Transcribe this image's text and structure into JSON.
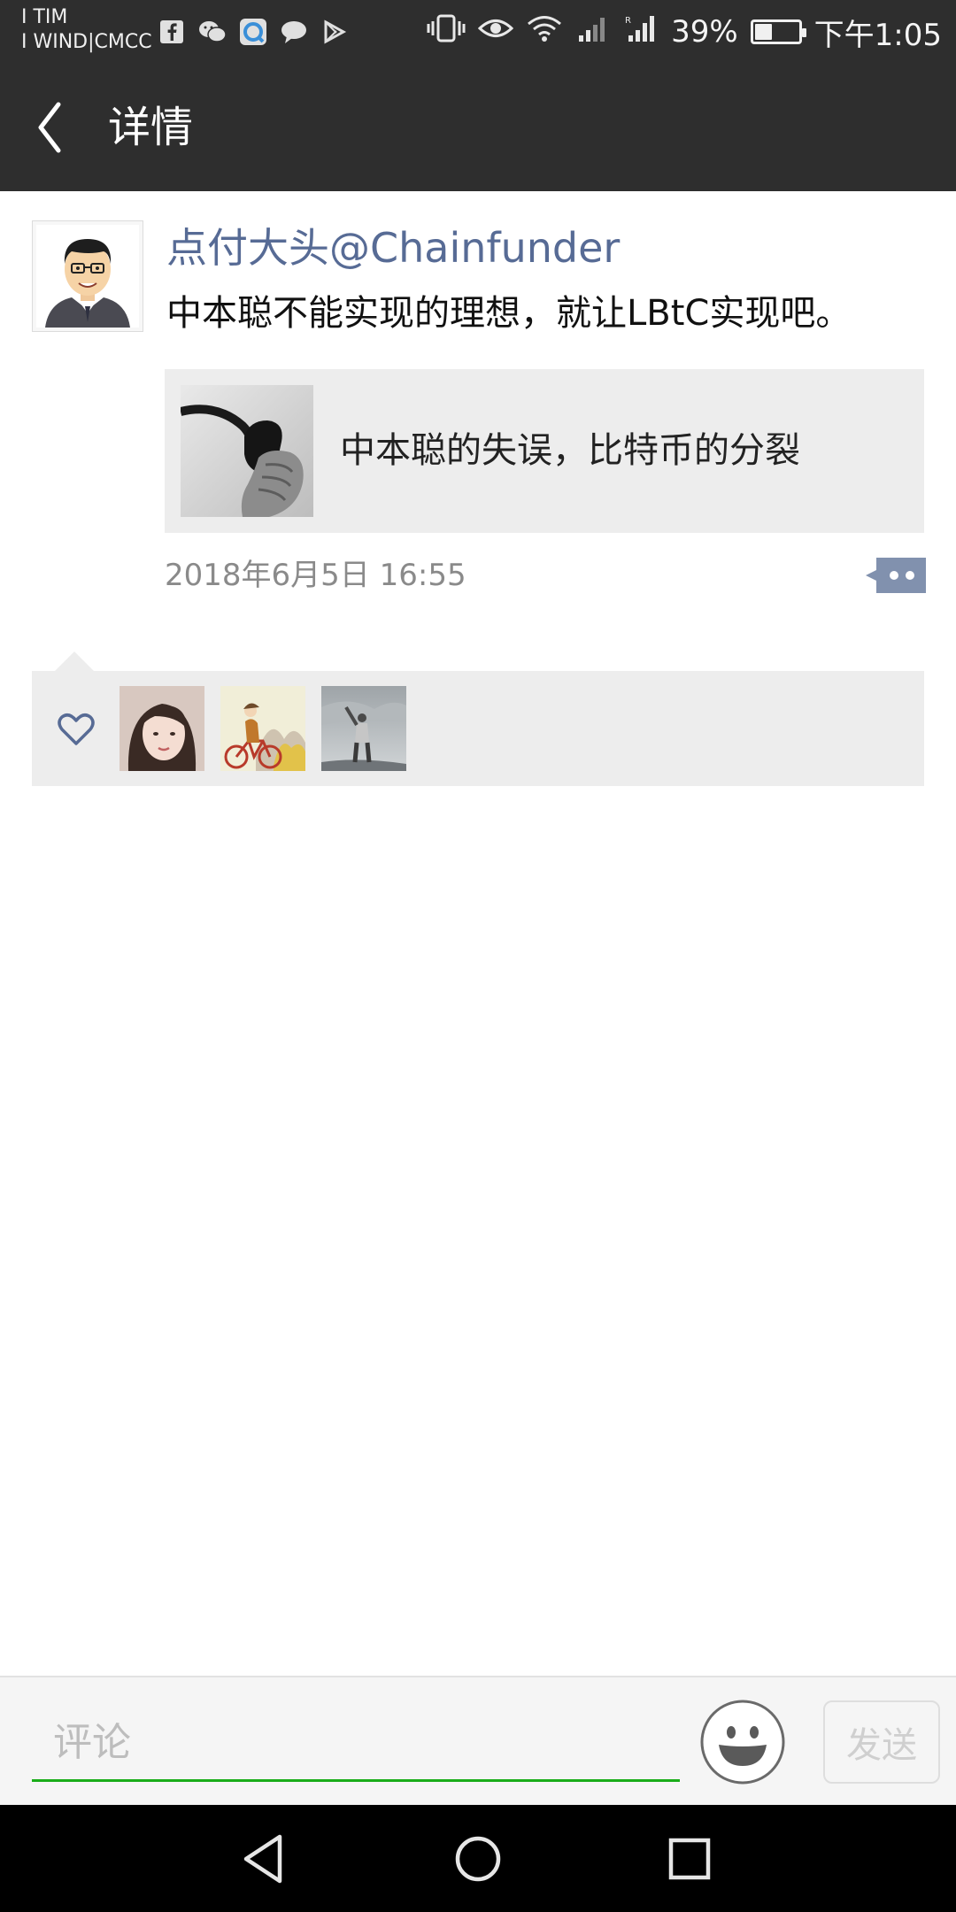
{
  "status_bar": {
    "carrier_line1": "I TIM",
    "carrier_line2": "I WIND|CMCC",
    "battery_percent": "39%",
    "battery_level": 0.39,
    "time": "下午1:05",
    "left_icons": [
      "facebook-icon",
      "wechat-icon",
      "qq-browser-icon",
      "message-icon",
      "play-store-icon"
    ],
    "right_icons": [
      "vibrate-icon",
      "eye-icon",
      "wifi-icon",
      "signal-icon",
      "signal-roaming-icon",
      "battery-icon"
    ]
  },
  "header": {
    "title": "详情"
  },
  "post": {
    "author": "点付大头@Chainfunder",
    "text": "中本聪不能实现的理想，就让LBtC实现吧。",
    "link_card": {
      "title": "中本聪的失误，比特币的分裂"
    },
    "timestamp": "2018年6月5日 16:55"
  },
  "likes": {
    "users": [
      "liker-avatar-1",
      "liker-avatar-2",
      "liker-avatar-3"
    ]
  },
  "comment_bar": {
    "placeholder": "评论",
    "send_label": "发送"
  },
  "colors": {
    "header_bg": "#2e2e2e",
    "author_link": "#576b95",
    "input_underline": "#1aad19",
    "card_bg": "#ededed"
  }
}
